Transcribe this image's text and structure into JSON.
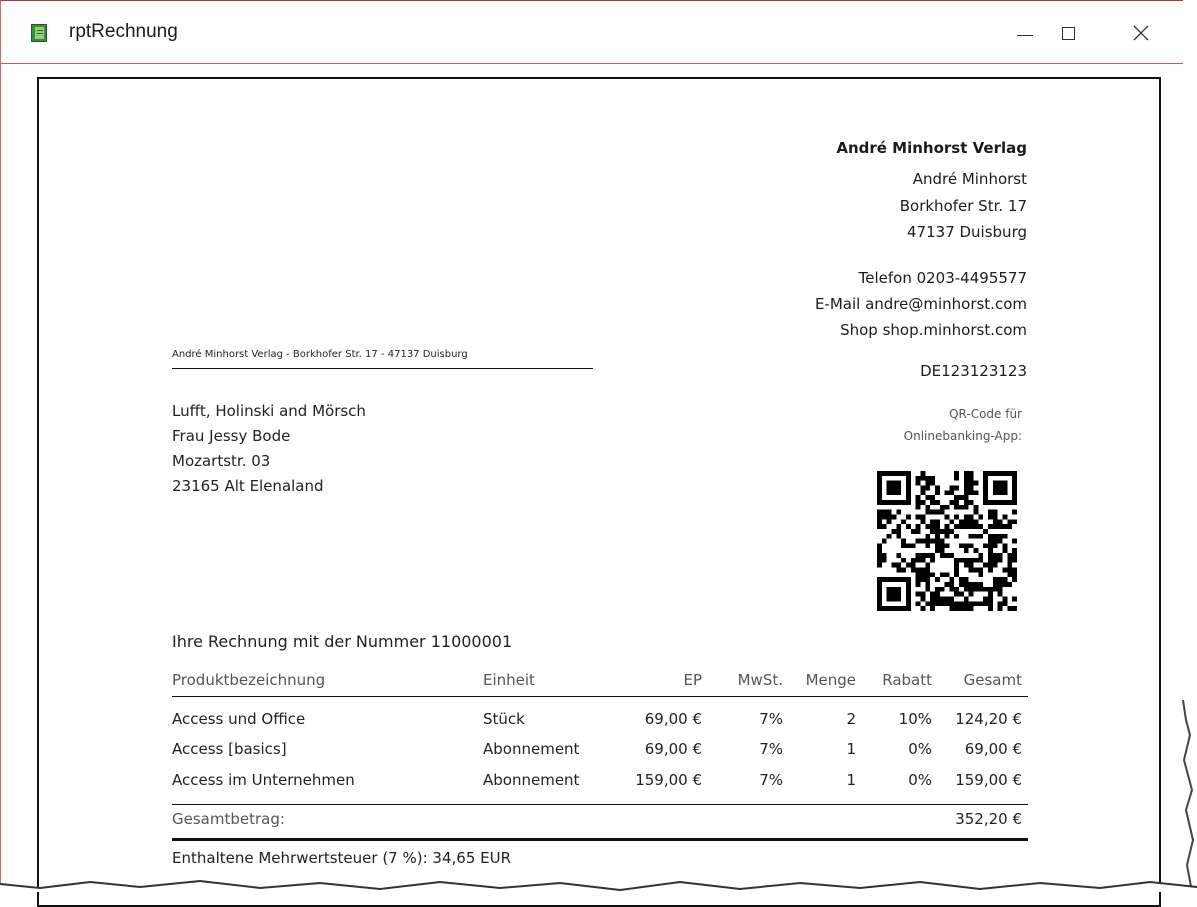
{
  "window": {
    "title": "rptRechnung"
  },
  "sender": {
    "company": "André Minhorst Verlag",
    "name": "André Minhorst",
    "street": "Borkhofer Str. 17",
    "city": "47137 Duisburg",
    "phone": "Telefon 0203-4495577",
    "email": "E-Mail andre@minhorst.com",
    "shop": "Shop shop.minhorst.com",
    "vat_id": "DE123123123",
    "return_line": "André Minhorst Verlag - Borkhofer Str. 17 - 47137 Duisburg"
  },
  "qr": {
    "label_1": "QR-Code für",
    "label_2": "Onlinebanking-App:"
  },
  "recipient": {
    "company": "Lufft, Holinski and Mörsch",
    "person": "Frau Jessy Bode",
    "street": "Mozartstr. 03",
    "city": "23165 Alt Elenaland"
  },
  "invoice": {
    "title": "Ihre Rechnung mit der Nummer 11000001"
  },
  "table": {
    "headers": {
      "product": "Produktbezeichnung",
      "unit": "Einheit",
      "ep": "EP",
      "vat": "MwSt.",
      "qty": "Menge",
      "discount": "Rabatt",
      "total": "Gesamt"
    },
    "rows": [
      {
        "product": "Access und Office",
        "unit": "Stück",
        "ep": "69,00 €",
        "vat": "7%",
        "qty": "2",
        "discount": "10%",
        "total": "124,20 €"
      },
      {
        "product": "Access [basics]",
        "unit": "Abonnement",
        "ep": "69,00 €",
        "vat": "7%",
        "qty": "1",
        "discount": "0%",
        "total": "69,00 €"
      },
      {
        "product": "Access im Unternehmen",
        "unit": "Abonnement",
        "ep": "159,00 €",
        "vat": "7%",
        "qty": "1",
        "discount": "0%",
        "total": "159,00 €"
      }
    ],
    "total_label": "Gesamtbetrag:",
    "total_value": "352,20 €"
  },
  "footer": {
    "vat_note": "Enthaltene Mehrwertsteuer (7 %): 34,65 EUR"
  }
}
